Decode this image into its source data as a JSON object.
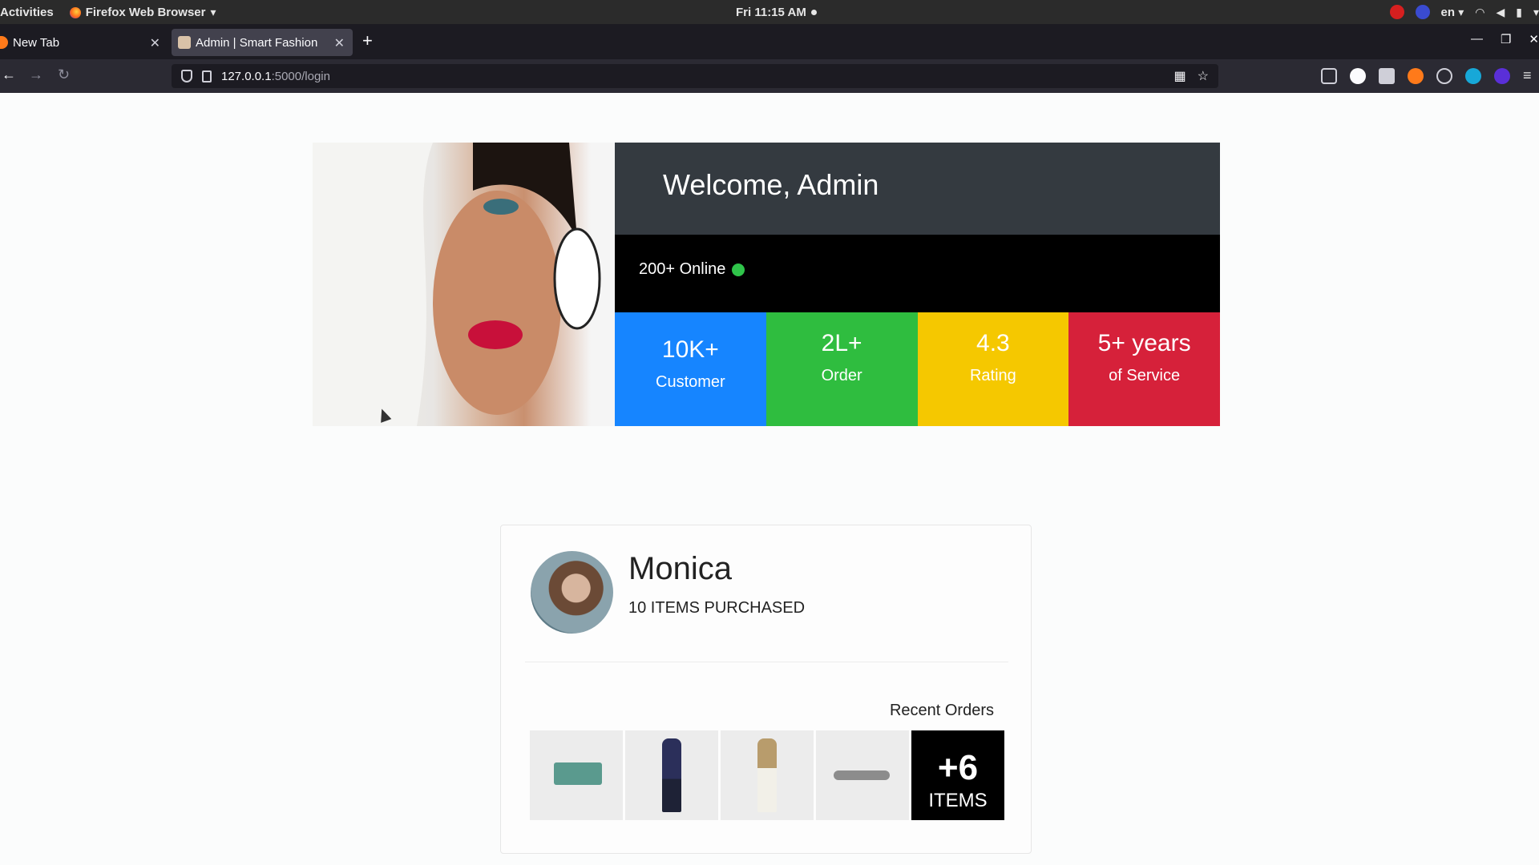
{
  "system_bar": {
    "activities": "Activities",
    "app_name": "Firefox Web Browser",
    "clock": "Fri 11:15 AM",
    "language": "en"
  },
  "browser": {
    "tabs": [
      {
        "title": "New Tab",
        "active": false
      },
      {
        "title": "Admin | Smart Fashion",
        "active": true
      }
    ],
    "url_host": "127.0.0.1",
    "url_path": ":5000/login"
  },
  "hero": {
    "welcome": "Welcome, Admin",
    "online": "200+ Online",
    "online_color": "#2fc44a",
    "stats": [
      {
        "value": "10K+",
        "label": "Customer",
        "color": "#1685ff"
      },
      {
        "value": "2L+",
        "label": "Order",
        "color": "#2fbd3f"
      },
      {
        "value": "4.3",
        "label": "Rating",
        "color": "#f5c800"
      },
      {
        "value": "5+ years",
        "label": "of Service",
        "color": "#d6213a"
      }
    ]
  },
  "customer_card": {
    "name": "Monica",
    "items_purchased": "10 ITEMS PURCHASED",
    "recent_orders_label": "Recent Orders",
    "more_count": "+6",
    "more_label": "ITEMS"
  },
  "colors": {
    "welcome_bg": "#343a40",
    "online_bg": "#000000"
  }
}
